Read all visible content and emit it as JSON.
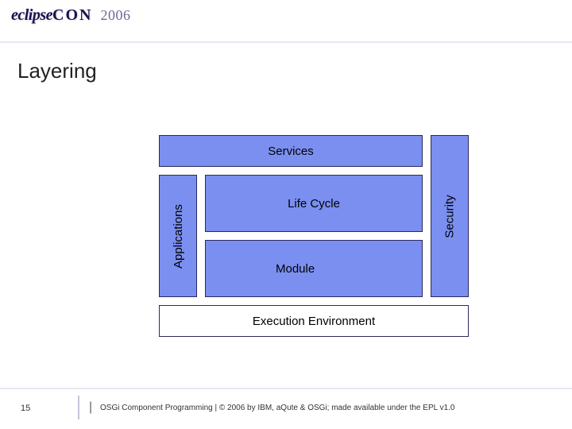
{
  "header": {
    "logo_text": "eclipse",
    "logo_suffix": "CON",
    "year": "2006"
  },
  "title": "Layering",
  "diagram": {
    "services": "Services",
    "applications": "Applications",
    "lifecycle": "Life Cycle",
    "module": "Module",
    "security": "Security",
    "execution_env": "Execution Environment"
  },
  "footer": {
    "page": "15",
    "text": "OSGi Component Programming | © 2006 by IBM, aQute & OSGi; made available under the EPL v1.0"
  }
}
